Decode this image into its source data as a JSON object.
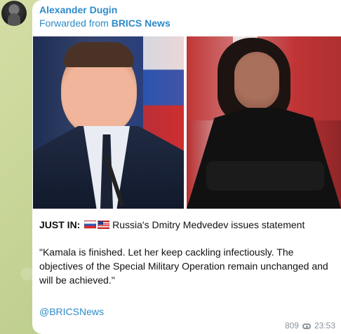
{
  "message": {
    "sender_name": "Alexander Dugin",
    "forwarded_prefix": "Forwarded from ",
    "forwarded_source": "BRICS News",
    "headline_label": "JUST IN:",
    "headline_text": "Russia's Dmitry Medvedev issues statement",
    "statement": "\"Kamala is finished. Let her keep cackling infectiously. The objectives of the Special Military Operation remain unchanged and will be achieved.\"",
    "source_link": "@BRICSNews",
    "views": "809",
    "time": "23:53"
  },
  "icons": {
    "avatar": "user-avatar",
    "flag_1": "russia-flag-icon",
    "flag_2": "usa-flag-icon",
    "views": "eye-icon"
  },
  "colors": {
    "sender": "#2d8bc9",
    "link": "#2d8bc9",
    "text": "#111111",
    "meta": "#8a949c",
    "background": "#c9d59a",
    "bubble": "#ffffff"
  }
}
